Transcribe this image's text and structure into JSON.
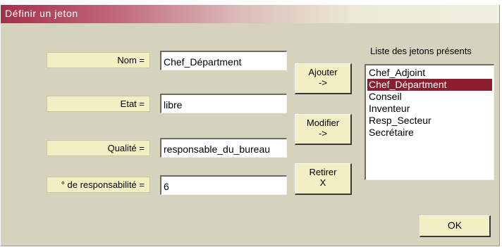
{
  "window": {
    "title": "Définir un jeton"
  },
  "fields": [
    {
      "label": "Nom =",
      "value": "Chef_Départment"
    },
    {
      "label": "Etat =",
      "value": "libre"
    },
    {
      "label": "Qualité =",
      "value": "responsable_du_bureau"
    },
    {
      "label": "° de responsabilité =",
      "value": "6"
    }
  ],
  "buttons": {
    "ajouter": {
      "line1": "Ajouter",
      "line2": "->"
    },
    "modifier": {
      "line1": "Modifier",
      "line2": "->"
    },
    "retirer": {
      "line1": "Retirer",
      "line2": "X"
    },
    "ok": "OK"
  },
  "list": {
    "title": "Liste des jetons présents",
    "items": [
      "Chef_Adjoint",
      "Chef_Départment",
      "Conseil",
      "Inventeur",
      "Resp_Secteur",
      "Secrétaire"
    ],
    "selected_index": 1
  },
  "colors": {
    "accent": "#a3304a",
    "panel": "#d5d2bd",
    "label_bg": "#f1efc3",
    "selection": "#8b1e2e"
  }
}
